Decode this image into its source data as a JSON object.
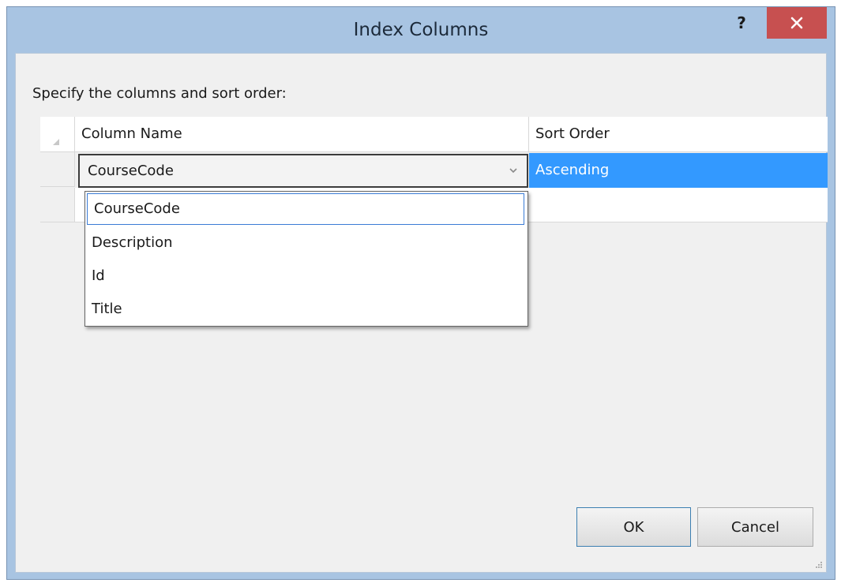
{
  "window": {
    "title": "Index Columns",
    "help_label": "?",
    "close_icon": "close-icon"
  },
  "dialog": {
    "prompt": "Specify the columns and sort order:"
  },
  "grid": {
    "columns": [
      "Column Name",
      "Sort Order"
    ],
    "rows": [
      {
        "column_name": "CourseCode",
        "sort_order": "Ascending"
      },
      {
        "column_name": "",
        "sort_order": ""
      }
    ]
  },
  "dropdown": {
    "selected": "CourseCode",
    "options": [
      "CourseCode",
      "Description",
      "Id",
      "Title"
    ]
  },
  "buttons": {
    "ok": "OK",
    "cancel": "Cancel"
  },
  "colors": {
    "title_bar": "#a8c4e2",
    "close_button": "#c75050",
    "selection": "#3399ff"
  }
}
